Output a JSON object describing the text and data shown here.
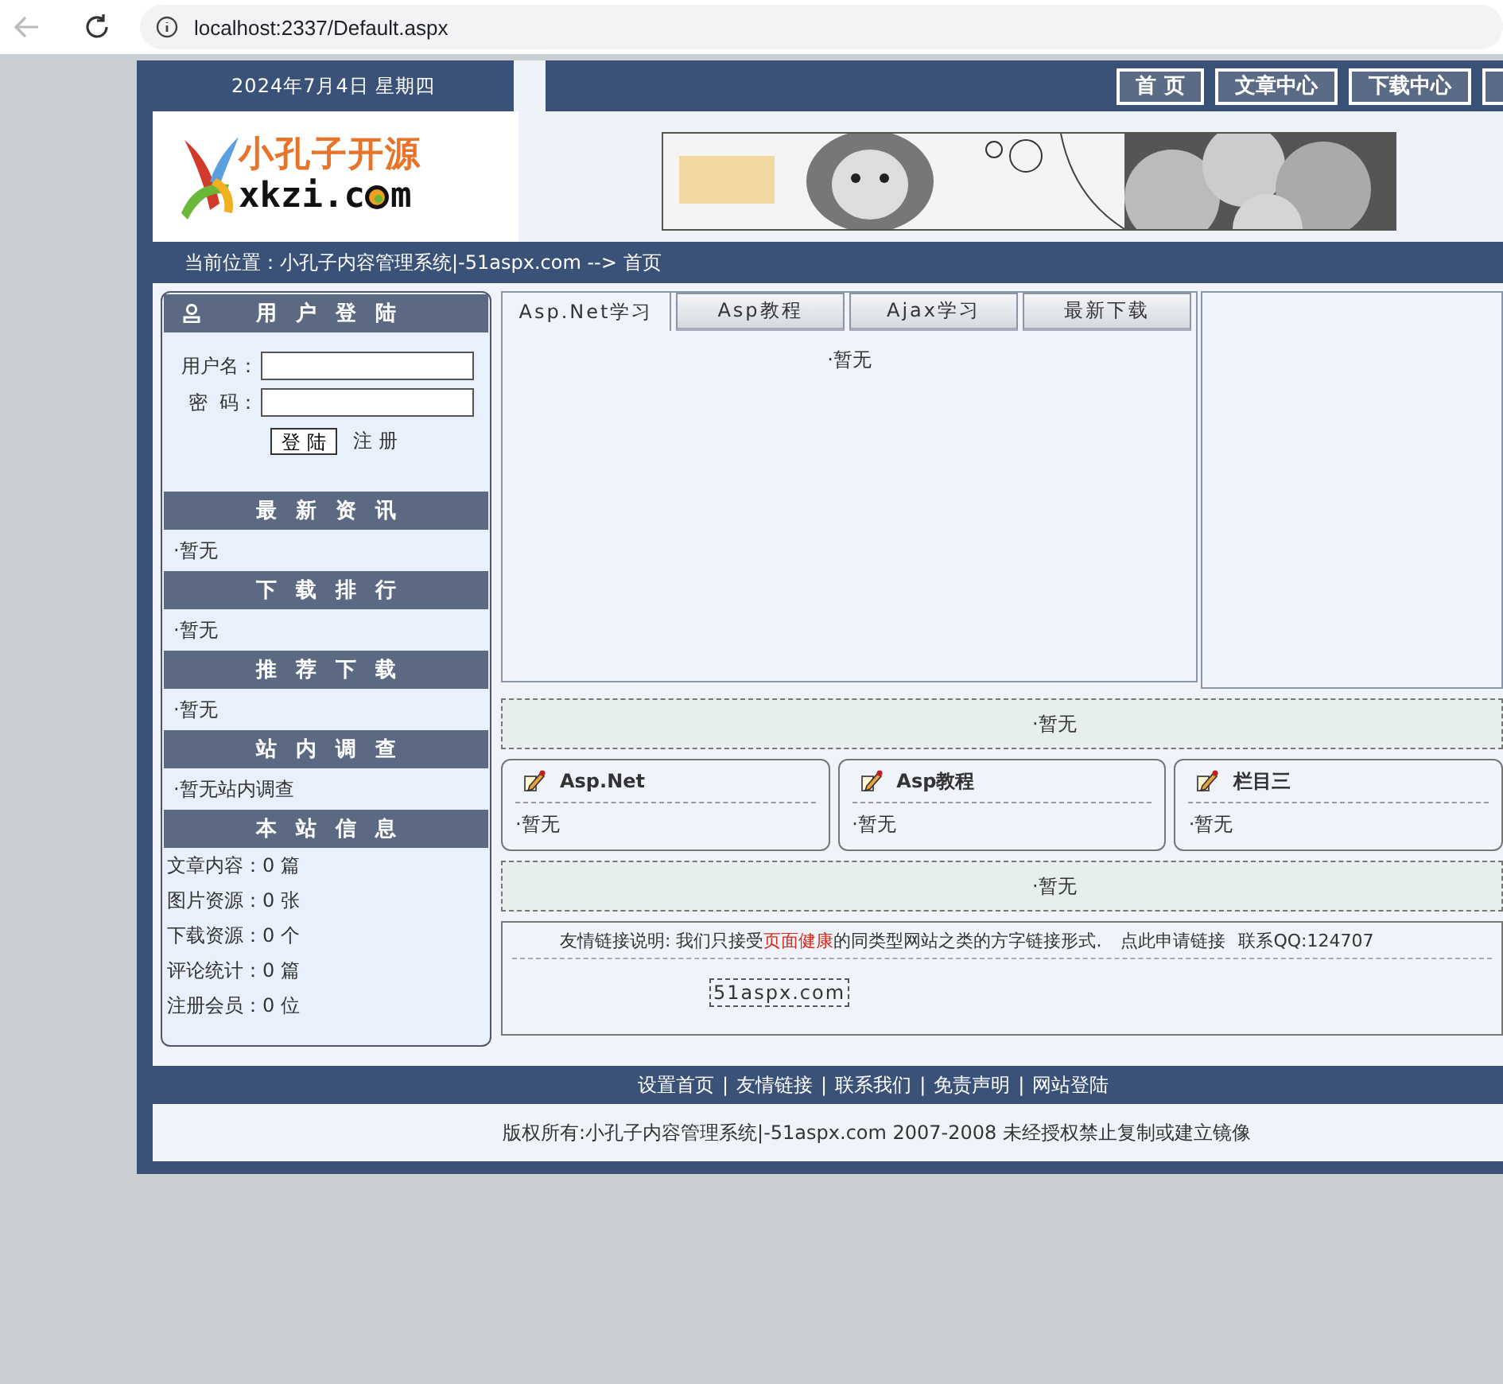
{
  "browser": {
    "url": "localhost:2337/Default.aspx"
  },
  "top": {
    "date": "2024年7月4日 星期四",
    "nav": [
      {
        "label": "首 页"
      },
      {
        "label": "文章中心"
      },
      {
        "label": "下载中心"
      }
    ]
  },
  "logo": {
    "title": "小孔子开源",
    "domain_start": "xkzi.c",
    "domain_end": "m"
  },
  "breadcrumb": "当前位置：小孔子内容管理系统|-51aspx.com --> 首页",
  "login": {
    "title": "用户登陆",
    "username_label": "用户名：",
    "password_label": "密  码：",
    "login_button": "登 陆",
    "register_link": "注 册"
  },
  "sidebar_sections": [
    {
      "title": "最新资讯",
      "items": [
        "·暂无"
      ]
    },
    {
      "title": "下载排行",
      "items": [
        "·暂无"
      ]
    },
    {
      "title": "推荐下载",
      "items": [
        "·暂无"
      ]
    },
    {
      "title": "站内调查",
      "items": [
        "·暂无站内调查"
      ]
    }
  ],
  "site_info": {
    "title": "本站信息",
    "lines": [
      "文章内容：0 篇",
      "图片资源：0 张",
      "下载资源：0 个",
      "评论统计：0 篇",
      "注册会员：0 位"
    ]
  },
  "tabs": [
    {
      "label": "Asp.Net学习",
      "selected": true
    },
    {
      "label": "Asp教程",
      "selected": false
    },
    {
      "label": "Ajax学习",
      "selected": false
    },
    {
      "label": "最新下载",
      "selected": false
    }
  ],
  "tab_content": "·暂无",
  "notice_bar_1": "·暂无",
  "cards": [
    {
      "title": "Asp.Net",
      "items": [
        "·暂无"
      ]
    },
    {
      "title": "Asp教程",
      "items": [
        "·暂无"
      ]
    },
    {
      "title": "栏目三",
      "items": [
        "·暂无"
      ]
    }
  ],
  "notice_bar_2": "·暂无",
  "friend_links": {
    "description": [
      {
        "kind": "text",
        "text": "友情链接说明:  我们只接受"
      },
      {
        "kind": "highlight",
        "text": "页面健康"
      },
      {
        "kind": "text",
        "text": "的同类型网站之类的方字链接形式."
      },
      {
        "kind": "link",
        "text": "点此申请链接"
      },
      {
        "kind": "text",
        "text": "联系QQ:124707"
      }
    ],
    "links": [
      "51aspx.com"
    ]
  },
  "footer": {
    "links": [
      "设置首页",
      "友情链接",
      "联系我们",
      "免责声明",
      "网站登陆"
    ],
    "separator": "|",
    "copyright": "版权所有:小孔子内容管理系统|-51aspx.com 2007-2008 未经授权禁止复制或建立镜像"
  }
}
